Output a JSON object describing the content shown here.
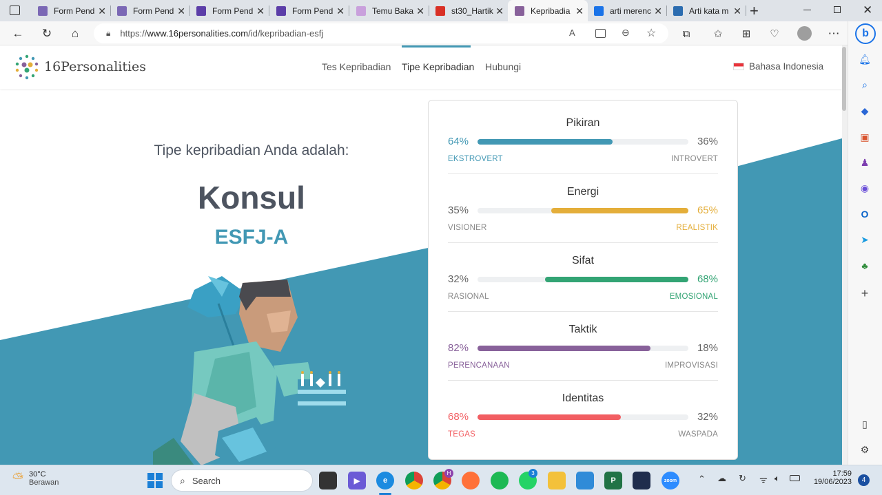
{
  "browser": {
    "tabs": [
      {
        "title": "Form Pend",
        "icon": "forms-icon",
        "color": "#7b68b5"
      },
      {
        "title": "Form Pend",
        "icon": "forms-icon",
        "color": "#7b68b5"
      },
      {
        "title": "Form Pend",
        "icon": "forms-icon",
        "color": "#5c3ea8"
      },
      {
        "title": "Form Pend",
        "icon": "forms-icon",
        "color": "#5c3ea8"
      },
      {
        "title": "Temu Baka",
        "icon": "pinwheel-icon",
        "color": "#c9a0dc"
      },
      {
        "title": "st30_Hartik",
        "icon": "pdf-icon",
        "color": "#d93025"
      },
      {
        "title": "Kepribadia",
        "icon": "16p-icon",
        "color": "#88619a"
      },
      {
        "title": "arti merenc",
        "icon": "search-icon",
        "color": "#1a73e8"
      },
      {
        "title": "Arti kata m",
        "icon": "j-icon",
        "color": "#2b6cb0"
      }
    ],
    "url_prefix": "https://",
    "url_host": "www.16personalities.com",
    "url_path": "/id/kepribadian-esfj"
  },
  "site": {
    "logo_text": "16Personalities",
    "nav": [
      "Tes Kepribadian",
      "Tipe Kepribadian",
      "Hubungi"
    ],
    "language": "Bahasa Indonesia"
  },
  "result": {
    "intro": "Tipe kepribadian Anda adalah:",
    "type_name": "Konsul",
    "type_code": "ESFJ-A"
  },
  "traits": [
    {
      "title": "Pikiran",
      "left_pct": "64%",
      "right_pct": "36%",
      "left_label": "EKSTROVERT",
      "right_label": "INTROVERT",
      "value": 64,
      "side": "left",
      "color": "#4298b4"
    },
    {
      "title": "Energi",
      "left_pct": "35%",
      "right_pct": "65%",
      "left_label": "VISIONER",
      "right_label": "REALISTIK",
      "value": 65,
      "side": "right",
      "color": "#e4ae3a"
    },
    {
      "title": "Sifat",
      "left_pct": "32%",
      "right_pct": "68%",
      "left_label": "RASIONAL",
      "right_label": "EMOSIONAL",
      "value": 68,
      "side": "right",
      "color": "#33a474"
    },
    {
      "title": "Taktik",
      "left_pct": "82%",
      "right_pct": "18%",
      "left_label": "PERENCANAAN",
      "right_label": "IMPROVISASI",
      "value": 82,
      "side": "left",
      "color": "#88619a"
    },
    {
      "title": "Identitas",
      "left_pct": "68%",
      "right_pct": "32%",
      "left_label": "TEGAS",
      "right_label": "WASPADA",
      "value": 68,
      "side": "left",
      "color": "#f25e62"
    }
  ],
  "taskbar": {
    "weather_temp": "30°C",
    "weather_desc": "Berawan",
    "search_placeholder": "Search",
    "time": "17:59",
    "date": "19/06/2023",
    "notif_count": "4",
    "whatsapp_badge": "3",
    "chrome_badge": "H"
  }
}
